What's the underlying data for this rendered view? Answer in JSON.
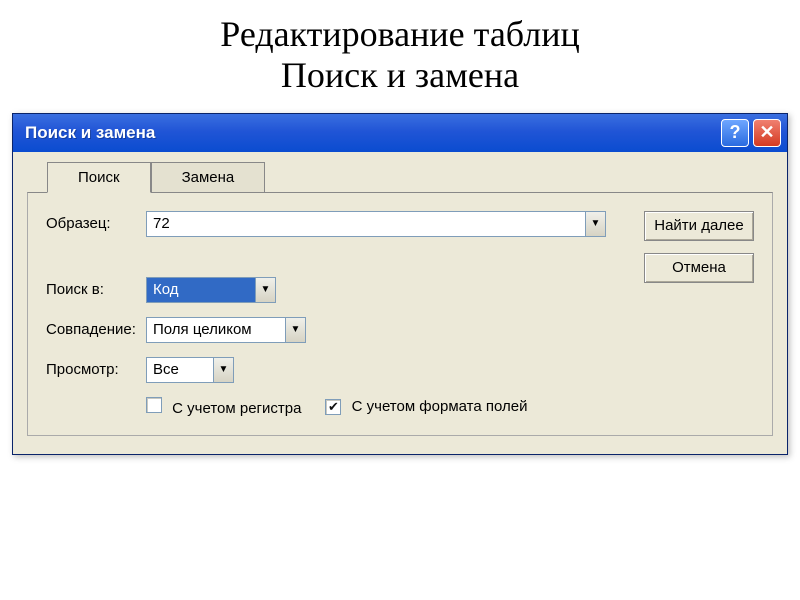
{
  "slide": {
    "title_line1": "Редактирование таблиц",
    "title_line2": "Поиск и замена"
  },
  "dialog": {
    "title": "Поиск и замена",
    "tabs": {
      "search": "Поиск",
      "replace": "Замена"
    },
    "fields": {
      "pattern_label": "Образец:",
      "pattern_value": "72",
      "search_in_label": "Поиск в:",
      "search_in_value": "Код",
      "match_label": "Совпадение:",
      "match_value": "Поля целиком",
      "view_label": "Просмотр:",
      "view_value": "Все"
    },
    "checkboxes": {
      "case_label": "С учетом регистра",
      "case_checked": false,
      "format_label": "С учетом формата полей",
      "format_checked": true
    },
    "buttons": {
      "find_next": "Найти далее",
      "cancel": "Отмена"
    }
  }
}
